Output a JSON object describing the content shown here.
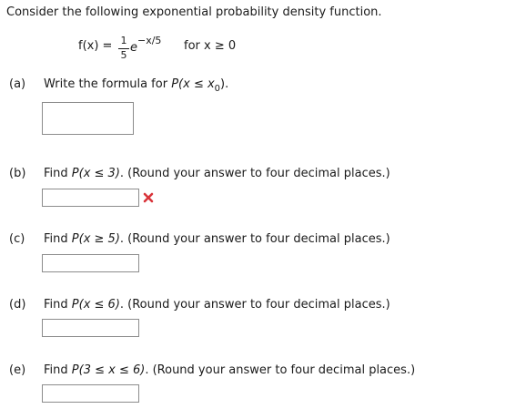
{
  "intro": "Consider the following exponential probability density function.",
  "formula": {
    "lhs": "f(x) =",
    "numerator": "1",
    "denominator": "5",
    "base": "e",
    "exponent": "−x/5",
    "domain": "for x ≥ 0"
  },
  "parts": [
    {
      "letter": "(a)",
      "text_before": "Write the formula for ",
      "expr": "P(x ≤ x",
      "sub": "0",
      "expr_after": ").",
      "suffix": "",
      "status": ""
    },
    {
      "letter": "(b)",
      "text_before": "Find ",
      "expr": "P(x ≤ 3)",
      "sub": "",
      "expr_after": "",
      "suffix": ". (Round your answer to four decimal places.)",
      "status": "incorrect"
    },
    {
      "letter": "(c)",
      "text_before": "Find ",
      "expr": "P(x ≥ 5)",
      "sub": "",
      "expr_after": "",
      "suffix": ". (Round your answer to four decimal places.)",
      "status": ""
    },
    {
      "letter": "(d)",
      "text_before": "Find ",
      "expr": "P(x ≤ 6)",
      "sub": "",
      "expr_after": "",
      "suffix": ". (Round your answer to four decimal places.)",
      "status": ""
    },
    {
      "letter": "(e)",
      "text_before": "Find ",
      "expr": "P(3 ≤ x ≤ 6)",
      "sub": "",
      "expr_after": "",
      "suffix": ". (Round your answer to four decimal places.)",
      "status": ""
    }
  ],
  "colors": {
    "incorrect": "#d9343a",
    "box_border": "#8c8c8c"
  }
}
